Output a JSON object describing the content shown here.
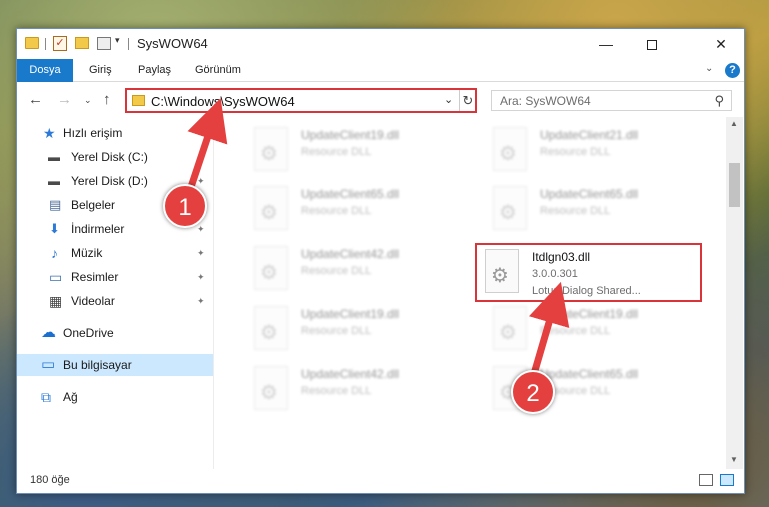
{
  "window": {
    "title": "SysWOW64",
    "qa_check_glyph": "✓",
    "min_glyph": "—",
    "close_glyph": "✕"
  },
  "ribbon": {
    "tabs": [
      "Dosya",
      "Giriş",
      "Paylaş",
      "Görünüm"
    ],
    "expand_glyph": "⌄",
    "help_glyph": "?"
  },
  "nav": {
    "back_glyph": "←",
    "forward_glyph": "→",
    "recent_glyph": "⌄",
    "up_glyph": "↑",
    "address": "C:\\Windows\\SysWOW64",
    "address_dropdown_glyph": "⌄",
    "refresh_glyph": "↻",
    "search_placeholder": "Ara: SysWOW64",
    "search_glyph": "⚲"
  },
  "sidebar": {
    "items": [
      {
        "label": "Hızlı erişim",
        "icon": "star-icon",
        "glyph": "★",
        "color": "#2d7ad6",
        "pinned": false
      },
      {
        "label": "Yerel Disk (C:)",
        "icon": "drive-icon",
        "glyph": "▬",
        "color": "#4a4a4a",
        "pinned": false
      },
      {
        "label": "Yerel Disk (D:)",
        "icon": "drive-icon",
        "glyph": "▬",
        "color": "#4a4a4a",
        "pinned": true
      },
      {
        "label": "Belgeler",
        "icon": "document-icon",
        "glyph": "▤",
        "color": "#4a6a9a",
        "pinned": true
      },
      {
        "label": "İndirmeler",
        "icon": "download-icon",
        "glyph": "⬇",
        "color": "#2d7ad6",
        "pinned": true
      },
      {
        "label": "Müzik",
        "icon": "music-icon",
        "glyph": "♪",
        "color": "#2d7ad6",
        "pinned": true
      },
      {
        "label": "Resimler",
        "icon": "pictures-icon",
        "glyph": "▭",
        "color": "#3c6fb0",
        "pinned": true
      },
      {
        "label": "Videolar",
        "icon": "video-icon",
        "glyph": "▦",
        "color": "#444",
        "pinned": true
      },
      {
        "label": "OneDrive",
        "icon": "cloud-icon",
        "glyph": "☁",
        "color": "#1a6fd0",
        "pinned": false
      },
      {
        "label": "Bu bilgisayar",
        "icon": "computer-icon",
        "glyph": "▭",
        "color": "#2d7ad6",
        "pinned": false,
        "selected": true
      },
      {
        "label": "Ağ",
        "icon": "network-icon",
        "glyph": "⧉",
        "color": "#2d7ad6",
        "pinned": false
      }
    ],
    "pin_glyph": "📌"
  },
  "files": [
    {
      "name": "UpdateClient19.dll",
      "line2": "Resource DLL",
      "line3": "",
      "blurred": true
    },
    {
      "name": "UpdateClient21.dll",
      "line2": "Resource DLL",
      "line3": "",
      "blurred": true
    },
    {
      "name": "UpdateClient65.dll",
      "line2": "Resource DLL",
      "line3": "",
      "blurred": true
    },
    {
      "name": "UpdateClient65.dll",
      "line2": "Resource DLL",
      "line3": "",
      "blurred": true
    },
    {
      "name": "UpdateClient42.dll",
      "line2": "Resource DLL",
      "line3": "",
      "blurred": true
    },
    {
      "name": "Itdlgn03.dll",
      "line2": "3.0.0.301",
      "line3": "Lotus Dialog Shared...",
      "blurred": false
    },
    {
      "name": "UpdateClient19.dll",
      "line2": "Resource DLL",
      "line3": "",
      "blurred": true
    },
    {
      "name": "UpdateClient19.dll",
      "line2": "Resource DLL",
      "line3": "",
      "blurred": true
    },
    {
      "name": "UpdateClient42.dll",
      "line2": "Resource DLL",
      "line3": "",
      "blurred": true
    },
    {
      "name": "UpdateClient65.dll",
      "line2": "Resource DLL",
      "line3": "",
      "blurred": true
    }
  ],
  "file_icon_glyph": "⚙",
  "scrollbar": {
    "up_glyph": "▲",
    "down_glyph": "▼"
  },
  "status": {
    "item_count": "180 öğe"
  },
  "annotations": [
    {
      "label": "1",
      "color": "#e3403f"
    },
    {
      "label": "2",
      "color": "#e3403f"
    }
  ]
}
